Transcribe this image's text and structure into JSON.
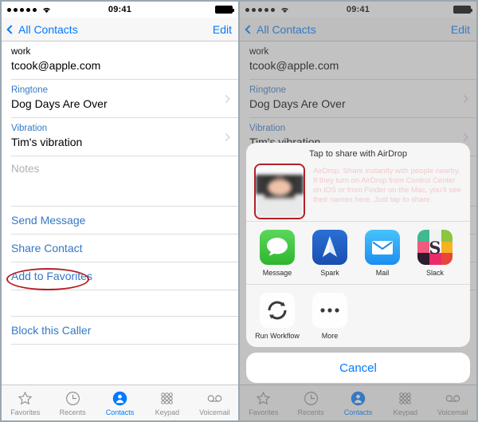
{
  "statusbar": {
    "time": "09:41",
    "signal_dots": 5,
    "wifi_icon": "wifi-icon",
    "battery_icon": "battery-full-icon"
  },
  "navbar": {
    "back_label": "All Contacts",
    "back_icon": "chevron-left-icon",
    "edit_label": "Edit"
  },
  "contact": {
    "work_label": "work",
    "work_value_left": "tcook@apple.com",
    "work_value_right": "tcook@apple.com",
    "ringtone_label": "Ringtone",
    "ringtone_value": "Dog Days Are Over",
    "vibration_label": "Vibration",
    "vibration_value": "Tim's vibration",
    "notes_placeholder": "Notes",
    "send_message": "Send Message",
    "share_contact": "Share Contact",
    "add_to_favorites": "Add to Favorites",
    "block_this_caller": "Block this Caller"
  },
  "tabbar": {
    "items": [
      {
        "label": "Favorites",
        "icon": "star-icon",
        "active": false
      },
      {
        "label": "Recents",
        "icon": "clock-icon",
        "active": false
      },
      {
        "label": "Contacts",
        "icon": "person-icon",
        "active": true
      },
      {
        "label": "Keypad",
        "icon": "keypad-grid-icon",
        "active": false
      },
      {
        "label": "Voicemail",
        "icon": "voicemail-icon",
        "active": false
      }
    ]
  },
  "sheet": {
    "airdrop_title": "Tap to share with AirDrop",
    "airdrop_description": "AirDrop. Share instantly with people nearby. If they turn on AirDrop from Control Center on iOS or from Finder on the Mac, you'll see their names here. Just tap to share.",
    "avatar_name": "airdrop-contact-avatar",
    "apps": [
      {
        "label": "Message",
        "icon": "messages-app-icon"
      },
      {
        "label": "Spark",
        "icon": "spark-app-icon"
      },
      {
        "label": "Mail",
        "icon": "mail-app-icon"
      },
      {
        "label": "Slack",
        "icon": "slack-app-icon"
      }
    ],
    "actions": [
      {
        "label": "Run Workflow",
        "icon": "refresh-arrows-icon"
      },
      {
        "label": "More",
        "icon": "ellipsis-icon"
      }
    ],
    "cancel_label": "Cancel"
  },
  "colors": {
    "ios_blue": "#007aff",
    "link_blue": "#3478c6",
    "annotation_red": "#b32025",
    "separator": "#dcdcdc",
    "bar_gray": "#f7f7f7"
  }
}
